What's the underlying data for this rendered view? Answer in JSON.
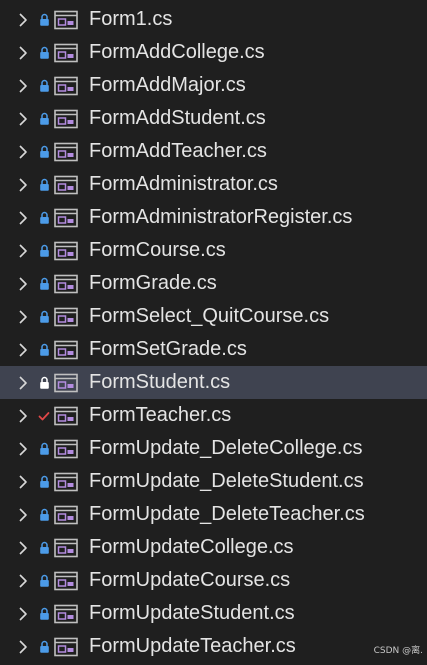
{
  "solution_explorer": {
    "items": [
      {
        "label": "Form1.cs",
        "status": "lock"
      },
      {
        "label": "FormAddCollege.cs",
        "status": "lock"
      },
      {
        "label": "FormAddMajor.cs",
        "status": "lock"
      },
      {
        "label": "FormAddStudent.cs",
        "status": "lock"
      },
      {
        "label": "FormAddTeacher.cs",
        "status": "lock"
      },
      {
        "label": "FormAdministrator.cs",
        "status": "lock"
      },
      {
        "label": "FormAdministratorRegister.cs",
        "status": "lock"
      },
      {
        "label": "FormCourse.cs",
        "status": "lock"
      },
      {
        "label": "FormGrade.cs",
        "status": "lock"
      },
      {
        "label": "FormSelect_QuitCourse.cs",
        "status": "lock"
      },
      {
        "label": "FormSetGrade.cs",
        "status": "lock"
      },
      {
        "label": "FormStudent.cs",
        "status": "lock",
        "selected": true
      },
      {
        "label": "FormTeacher.cs",
        "status": "checked-out"
      },
      {
        "label": "FormUpdate_DeleteCollege.cs",
        "status": "lock"
      },
      {
        "label": "FormUpdate_DeleteStudent.cs",
        "status": "lock"
      },
      {
        "label": "FormUpdate_DeleteTeacher.cs",
        "status": "lock"
      },
      {
        "label": "FormUpdateCollege.cs",
        "status": "lock"
      },
      {
        "label": "FormUpdateCourse.cs",
        "status": "lock"
      },
      {
        "label": "FormUpdateStudent.cs",
        "status": "lock"
      },
      {
        "label": "FormUpdateTeacher.cs",
        "status": "lock"
      }
    ],
    "icons": {
      "expander": "chevron-right-icon",
      "lock": "lock-icon",
      "checked_out": "checkmark-icon",
      "form": "windows-form-icon"
    },
    "colors": {
      "background": "#1f1f1f",
      "selected_row": "#3f4350",
      "text": "#e4e4e4",
      "lock": "#4c9be8",
      "lock_selected": "#ffffff",
      "checkmark": "#e04848",
      "form_icon_frame": "#c0c0c0",
      "form_icon_inner": "#b38cdf"
    }
  },
  "watermark": "CSDN @离."
}
